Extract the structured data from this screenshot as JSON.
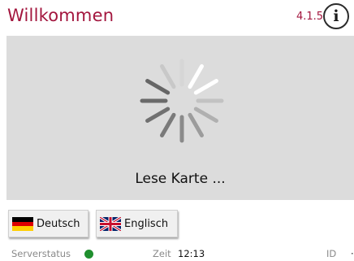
{
  "header": {
    "title": "Willkommen",
    "version": "4.1.5",
    "info_glyph": "i"
  },
  "main": {
    "status_text": "Lese Karte ..."
  },
  "languages": [
    {
      "label": "Deutsch",
      "flag": "german-flag-icon"
    },
    {
      "label": "Englisch",
      "flag": "uk-flag-icon"
    }
  ],
  "footer": {
    "server_label": "Serverstatus",
    "server_status_color": "#1f8f2e",
    "time_label": "Zeit",
    "time_value": "12:13",
    "id_label": "ID",
    "id_value": "·"
  },
  "colors": {
    "accent": "#a3163e",
    "panel": "#dcdcdc"
  }
}
